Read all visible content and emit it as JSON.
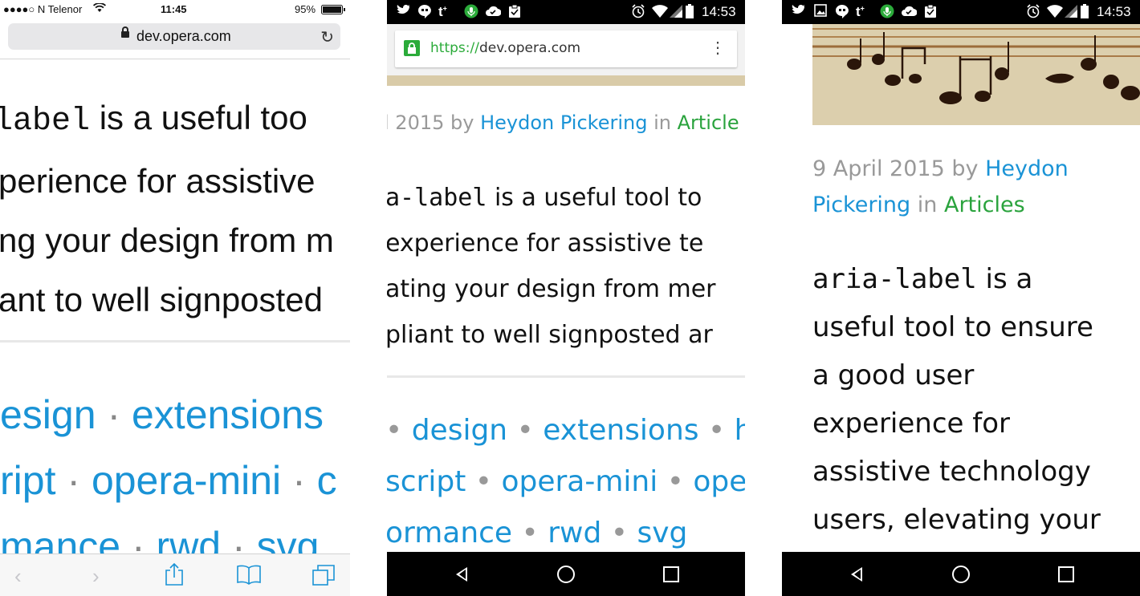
{
  "ios": {
    "status": {
      "carrier": "●●●●○ N Telenor",
      "time": "11:45",
      "battery": "95%"
    },
    "address_bar": {
      "host": "dev.opera.com"
    },
    "body_lines": [
      {
        "code": "label",
        "text": " is a useful too"
      },
      {
        "text": "perience for assistive"
      },
      {
        "text": "ng your design from m"
      },
      {
        "text": "ant to well signposted"
      }
    ],
    "tags_lines": [
      [
        "esign",
        "extensions"
      ],
      [
        "ript",
        "opera-mini",
        "c"
      ],
      [
        "mance",
        "rwd",
        "svg"
      ]
    ],
    "tag_separator": "·"
  },
  "android_chrome": {
    "status": {
      "time": "14:53"
    },
    "address_bar": {
      "scheme": "https://",
      "host": "dev.opera.com"
    },
    "meta": {
      "prefix": "l 2015 by ",
      "author": "Heydon Pickering",
      "in": " in ",
      "category": "Article"
    },
    "body_lines": [
      {
        "code": "a-label",
        "text": " is a useful tool to"
      },
      {
        "text": " experience for assistive te"
      },
      {
        "text": "ating your design from mer"
      },
      {
        "text": "pliant to well signposted ar"
      }
    ],
    "tags_lines": [
      [
        "",
        "design",
        "extensions",
        "ht"
      ],
      [
        "script",
        "opera-mini",
        "oper"
      ],
      [
        "ormance",
        "rwd",
        "svg"
      ]
    ],
    "tag_separator": "•"
  },
  "android_opera": {
    "status": {
      "time": "14:53"
    },
    "meta": {
      "date": "9 April 2015 by ",
      "author_1": "Heydon",
      "author_2": "Pickering",
      "in": " in ",
      "category": "Articles"
    },
    "body_lines": [
      {
        "code": "aria-label",
        "text": " is a"
      },
      {
        "text": "useful tool to ensure"
      },
      {
        "text": "a good user"
      },
      {
        "text": "experience for"
      },
      {
        "text": "assistive technology"
      },
      {
        "text": "users, elevating your"
      }
    ]
  },
  "colors": {
    "link": "#1a93d6",
    "category": "#2aa33d",
    "meta": "#999999",
    "secure": "#2bab3a"
  }
}
